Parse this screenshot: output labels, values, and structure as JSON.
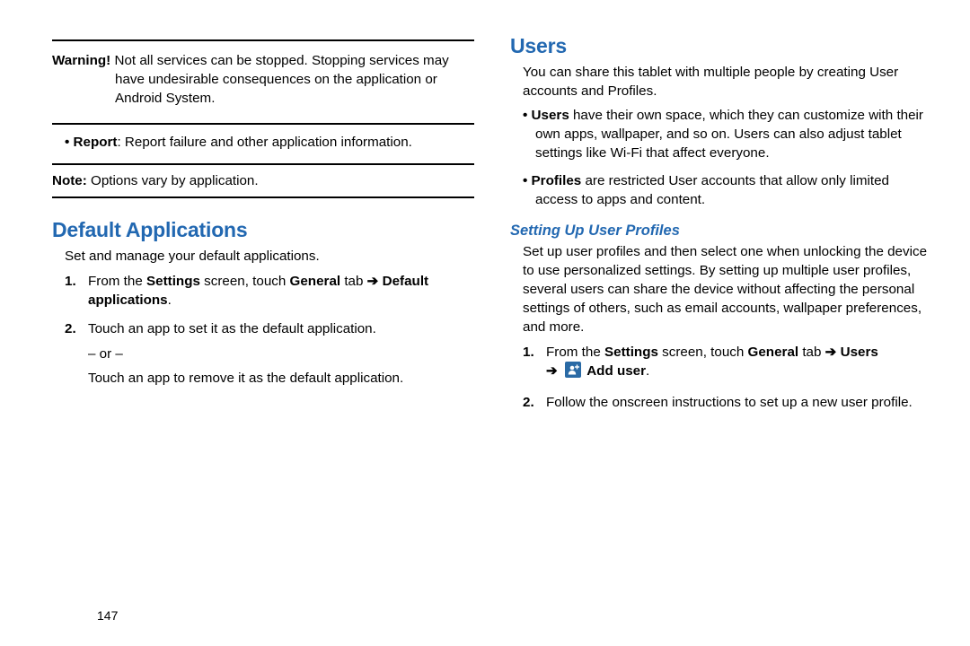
{
  "page_number": "147",
  "left": {
    "warning_label": "Warning!",
    "warning_text": " Not all services can be stopped. Stopping services may have undesirable consequences on the application or Android System.",
    "report_label": "Report",
    "report_text": ": Report failure and other application information.",
    "note_label": "Note:",
    "note_text": " Options vary by application.",
    "h_default_apps": "Default Applications",
    "default_apps_intro": "Set and manage your default applications.",
    "step1_pre": "From the ",
    "step1_settings": "Settings",
    "step1_mid": " screen, touch ",
    "step1_general": "General",
    "step1_tab": " tab ",
    "arrow": "➔",
    "step1_end": "Default applications",
    "step1_period": ".",
    "step2_a": "Touch an app to set it as the default application.",
    "step2_or": "– or –",
    "step2_b": "Touch an app to remove it as the default application."
  },
  "right": {
    "h_users": "Users",
    "users_intro": "You can share this tablet with multiple people by creating User accounts and Profiles.",
    "bullet1_label": "Users",
    "bullet1_text": " have their own space, which they can customize with their own apps, wallpaper, and so on. Users can also adjust tablet settings like Wi-Fi that affect everyone.",
    "bullet2_label": "Profiles",
    "bullet2_text": " are restricted User accounts that allow only limited access to apps and content.",
    "h_setup": "Setting Up User Profiles",
    "setup_intro": "Set up user profiles and then select one when unlocking the device to use personalized settings. By setting up multiple user profiles, several users can share the device without affecting the personal settings of others, such as email accounts, wallpaper preferences, and more.",
    "step1_pre": "From the ",
    "step1_settings": "Settings",
    "step1_mid": " screen, touch ",
    "step1_general": "General",
    "step1_tab": " tab ",
    "arrow": "➔",
    "step1_users": "Users",
    "step1_adduser": "Add user",
    "step1_period": ".",
    "step2": "Follow the onscreen instructions to set up a new user profile."
  }
}
